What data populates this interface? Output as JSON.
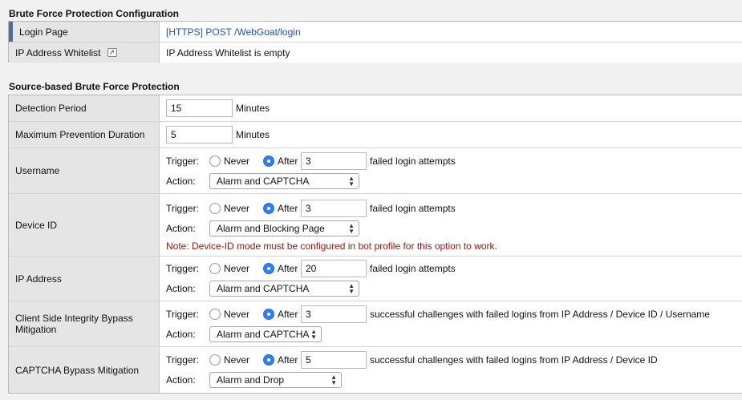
{
  "section1": {
    "title": "Brute Force Protection Configuration",
    "login_page_label": "Login Page",
    "login_page_value": "[HTTPS] POST /WebGoat/login",
    "whitelist_label": "IP Address Whitelist",
    "whitelist_icon": "external-link-icon",
    "whitelist_value": "IP Address Whitelist is empty"
  },
  "section2": {
    "title": "Source-based Brute Force Protection",
    "detection_period": {
      "label": "Detection Period",
      "value": "15",
      "unit": "Minutes"
    },
    "max_prevention": {
      "label": "Maximum Prevention Duration",
      "value": "5",
      "unit": "Minutes"
    },
    "trigger_label": "Trigger:",
    "action_label": "Action:",
    "never_label": "Never",
    "after_label": "After",
    "rows": {
      "username": {
        "label": "Username",
        "selected": "After",
        "count": "3",
        "after_text": "failed login attempts",
        "action": "Alarm and CAPTCHA"
      },
      "device_id": {
        "label": "Device ID",
        "selected": "After",
        "count": "3",
        "after_text": "failed login attempts",
        "action": "Alarm and Blocking Page",
        "note": "Note: Device-ID mode must be configured in bot profile for this option to work."
      },
      "ip_address": {
        "label": "IP Address",
        "selected": "After",
        "count": "20",
        "after_text": "failed login attempts",
        "action": "Alarm and CAPTCHA"
      },
      "csi_bypass": {
        "label": "Client Side Integrity Bypass Mitigation",
        "selected": "After",
        "count": "3",
        "after_text": "successful challenges with failed logins from IP Address / Device ID / Username",
        "action": "Alarm and CAPTCHA"
      },
      "captcha_bypass": {
        "label": "CAPTCHA Bypass Mitigation",
        "selected": "After",
        "count": "5",
        "after_text": "successful challenges with failed logins from IP Address / Device ID",
        "action": "Alarm and Drop"
      }
    }
  },
  "colors": {
    "accent": "#4b6c9c",
    "link": "#2255aa",
    "note": "#8b1a10",
    "radio_selected": "#2f7ef6"
  }
}
